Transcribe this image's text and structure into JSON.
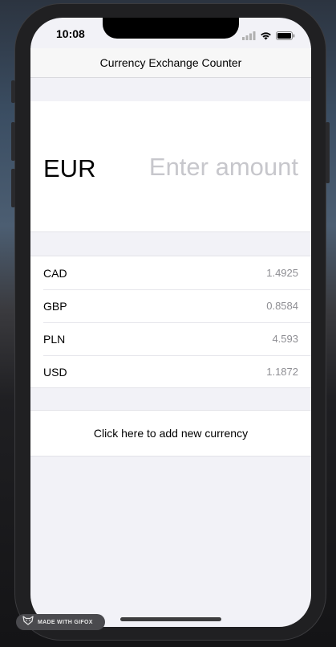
{
  "status_bar": {
    "time": "10:08",
    "icons": [
      "cellular-signal-icon",
      "wifi-icon",
      "battery-icon"
    ]
  },
  "nav": {
    "title": "Currency Exchange Counter"
  },
  "base_currency": {
    "code": "EUR",
    "amount_value": "",
    "amount_placeholder": "Enter amount"
  },
  "rates": [
    {
      "code": "CAD",
      "value": "1.4925"
    },
    {
      "code": "GBP",
      "value": "0.8584"
    },
    {
      "code": "PLN",
      "value": "4.593"
    },
    {
      "code": "USD",
      "value": "1.1872"
    }
  ],
  "add_currency": {
    "label": "Click here to add new currency"
  },
  "watermark": {
    "label": "MADE WITH GIFOX",
    "icon": "fox-logo-icon"
  },
  "colors": {
    "background": "#f2f2f7",
    "placeholder": "#c7c7cc",
    "rate_value": "#8e8e93"
  }
}
